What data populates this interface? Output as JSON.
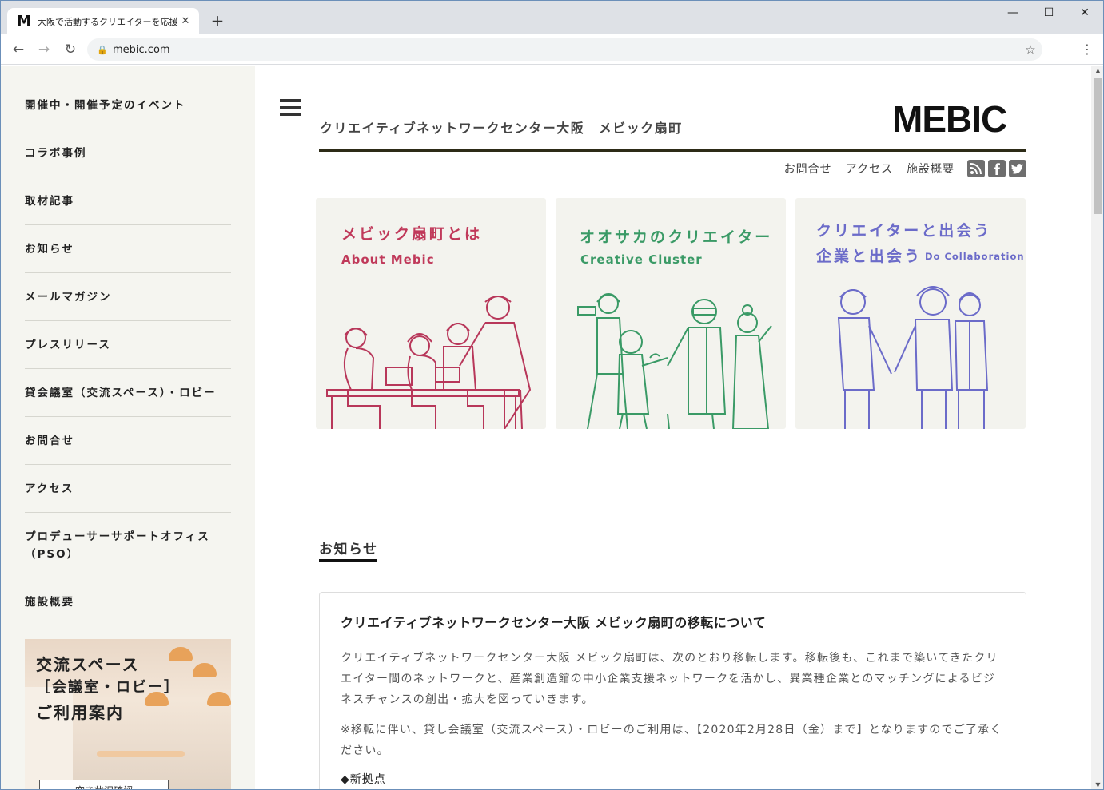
{
  "browser": {
    "tab_title": "大阪で活動するクリエイターを応援す",
    "favicon_letter": "M",
    "url": "mebic.com",
    "new_tab_symbol": "+",
    "close_tab_symbol": "✕",
    "minimize_symbol": "—",
    "maximize_symbol": "☐",
    "close_window_symbol": "✕",
    "back_symbol": "←",
    "forward_symbol": "→",
    "reload_symbol": "↻",
    "lock_symbol": "🔒",
    "star_symbol": "☆",
    "menu_symbol": "⋮"
  },
  "sidebar": {
    "items": [
      {
        "label": "開催中・開催予定のイベント"
      },
      {
        "label": "コラボ事例"
      },
      {
        "label": "取材記事"
      },
      {
        "label": "お知らせ"
      },
      {
        "label": "メールマガジン"
      },
      {
        "label": "プレスリリース"
      },
      {
        "label": "貸会議室（交流スペース）・ロビー"
      },
      {
        "label": "お問合せ"
      },
      {
        "label": "アクセス"
      },
      {
        "label": "プロデューサーサポートオフィス（PSO）"
      },
      {
        "label": "施設概要"
      }
    ],
    "banner": {
      "line1": "交流スペース",
      "line2": "［会議室・ロビー］",
      "line3": "ご利用案内",
      "button_label": "空き状況確認"
    }
  },
  "header": {
    "site_title": "クリエイティブネットワークセンター大阪　メビック扇町",
    "logo": "MEBIC",
    "utility_links": [
      "お問合せ",
      "アクセス",
      "施設概要"
    ],
    "social_icons": [
      "rss-icon",
      "facebook-icon",
      "twitter-icon"
    ]
  },
  "cards": [
    {
      "heading": "メビック扇町とは",
      "sub": "About Mebic",
      "color": "#c0395a"
    },
    {
      "heading": "オオサカのクリエイター",
      "sub": "Creative Cluster",
      "color": "#3a9a66"
    },
    {
      "heading_line1": "クリエイターと出会う",
      "heading_line2": "企業と出会う",
      "sub": "Do Collaboration",
      "color": "#6b6bc9"
    }
  ],
  "news": {
    "section_heading": "お知らせ",
    "title": "クリエイティブネットワークセンター大阪 メビック扇町の移転について",
    "body1": "クリエイティブネットワークセンター大阪 メビック扇町は、次のとおり移転します。移転後も、これまで築いてきたクリエイター間のネットワークと、産業創造館の中小企業支援ネットワークを活かし、異業種企業とのマッチングによるビジネスチャンスの創出・拡大を図っていきます。",
    "body2": "※移転に伴い、貸し会議室（交流スペース）・ロビーのご利用は、【2020年2月28日（金）まで】となりますのでご了承ください。",
    "subheading": "◆新拠点"
  }
}
